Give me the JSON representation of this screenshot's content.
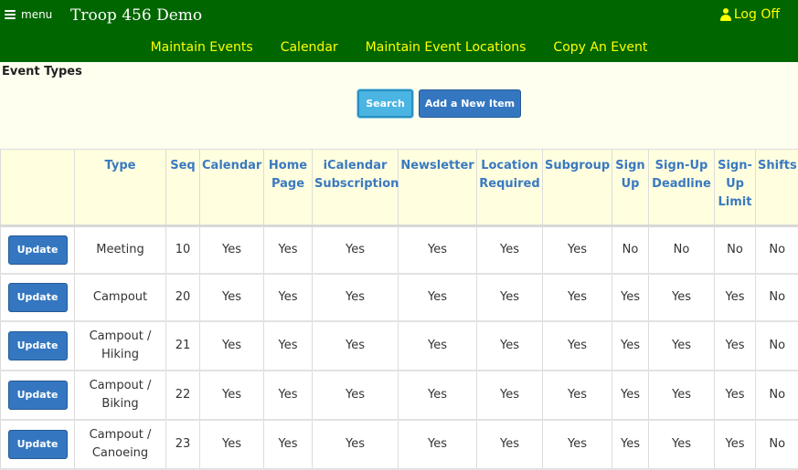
{
  "header": {
    "menu_label": "menu",
    "title": "Troop 456 Demo",
    "logoff_label": "Log Off",
    "nav": [
      "Maintain Events",
      "Calendar",
      "Maintain Event Locations",
      "Copy An Event"
    ]
  },
  "page": {
    "heading": "Event Types",
    "search_label": "Search",
    "add_label": "Add a New Item"
  },
  "table": {
    "columns": [
      "",
      "Type",
      "Seq",
      "Calendar",
      "Home Page",
      "iCalendar Subscription",
      "Newsletter",
      "Location Required",
      "Subgroup",
      "Sign Up",
      "Sign-Up Deadline",
      "Sign-Up Limit",
      "Shifts"
    ],
    "update_label": "Update",
    "rows": [
      {
        "type": "Meeting",
        "seq": "10",
        "calendar": "Yes",
        "home_page": "Yes",
        "icalendar": "Yes",
        "newsletter": "Yes",
        "location_required": "Yes",
        "subgroup": "Yes",
        "sign_up": "No",
        "deadline": "No",
        "limit": "No",
        "shifts": "No"
      },
      {
        "type": "Campout",
        "seq": "20",
        "calendar": "Yes",
        "home_page": "Yes",
        "icalendar": "Yes",
        "newsletter": "Yes",
        "location_required": "Yes",
        "subgroup": "Yes",
        "sign_up": "Yes",
        "deadline": "Yes",
        "limit": "Yes",
        "shifts": "No"
      },
      {
        "type": "Campout / Hiking",
        "seq": "21",
        "calendar": "Yes",
        "home_page": "Yes",
        "icalendar": "Yes",
        "newsletter": "Yes",
        "location_required": "Yes",
        "subgroup": "Yes",
        "sign_up": "Yes",
        "deadline": "Yes",
        "limit": "Yes",
        "shifts": "No"
      },
      {
        "type": "Campout / Biking",
        "seq": "22",
        "calendar": "Yes",
        "home_page": "Yes",
        "icalendar": "Yes",
        "newsletter": "Yes",
        "location_required": "Yes",
        "subgroup": "Yes",
        "sign_up": "Yes",
        "deadline": "Yes",
        "limit": "Yes",
        "shifts": "No"
      },
      {
        "type": "Campout / Canoeing",
        "seq": "23",
        "calendar": "Yes",
        "home_page": "Yes",
        "icalendar": "Yes",
        "newsletter": "Yes",
        "location_required": "Yes",
        "subgroup": "Yes",
        "sign_up": "Yes",
        "deadline": "Yes",
        "limit": "Yes",
        "shifts": "No"
      }
    ]
  },
  "colors": {
    "header_bg": "#006600",
    "nav_link": "#ffff00",
    "header_cell_bg": "#ffffe0",
    "header_text": "#3a79c0",
    "button_blue": "#3477c0",
    "search_button": "#4ab5e2"
  },
  "icons": {
    "menu": "hamburger-icon",
    "logoff": "user-icon"
  }
}
